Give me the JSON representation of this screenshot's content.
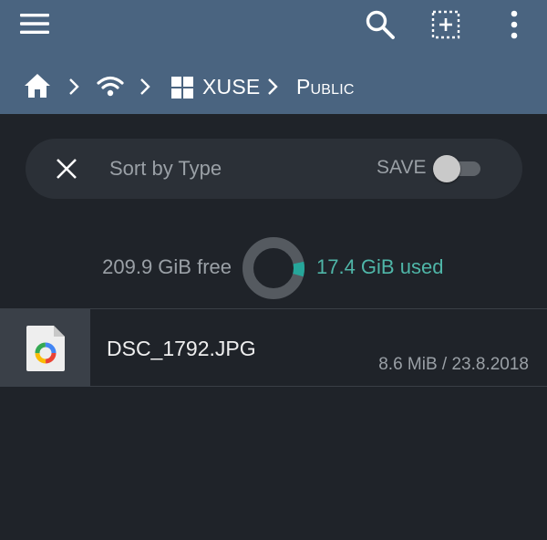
{
  "toolbar": {
    "icons": [
      "menu-icon",
      "search-icon",
      "select-icon",
      "more-vert-icon"
    ]
  },
  "breadcrumb": {
    "items": [
      {
        "icon": "home-icon"
      },
      {
        "icon": "wifi-icon"
      },
      {
        "icon": "windows-icon",
        "label": "XUSE"
      },
      {
        "label": "Public"
      }
    ]
  },
  "sort": {
    "label": "Sort by Type",
    "save_label": "SAVE",
    "save_enabled": false
  },
  "storage": {
    "free": "209.9 GiB free",
    "used": "17.4 GiB used",
    "used_fraction": 0.077,
    "used_color": "#26a69a",
    "track_color": "#555a60"
  },
  "files": [
    {
      "name": "DSC_1792.JPG",
      "meta": "8.6 MiB / 23.8.2018",
      "icon": "image-file-icon"
    }
  ],
  "colors": {
    "toolbar": "#4a6480",
    "background": "#1f2329",
    "accent": "#4fb6a8"
  }
}
